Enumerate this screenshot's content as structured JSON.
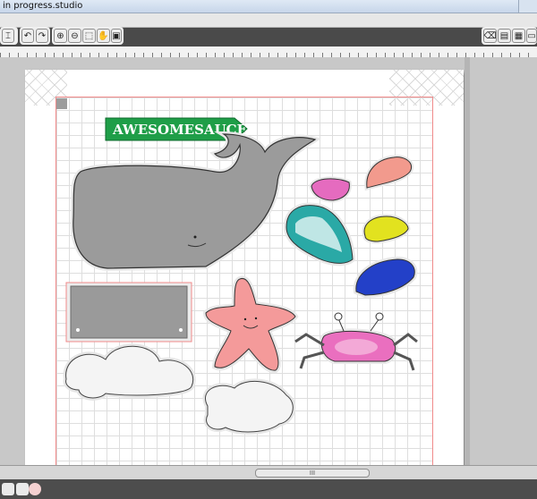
{
  "window": {
    "title": "in progress.studio"
  },
  "toolbar": {
    "undo_icon": "undo-icon",
    "redo_icon": "redo-icon",
    "zoom_in_icon": "zoom-in-icon",
    "zoom_out_icon": "zoom-out-icon",
    "zoom_select_icon": "zoom-select-icon",
    "pan_icon": "pan-hand-icon",
    "fit_icon": "fit-page-icon"
  },
  "canvas": {
    "banner_text": "AWESOMESAUCE",
    "banner_color": "#1f9e48",
    "mat_border_color": "#f08a8a"
  },
  "scroll": {
    "thumb_label": "III"
  }
}
